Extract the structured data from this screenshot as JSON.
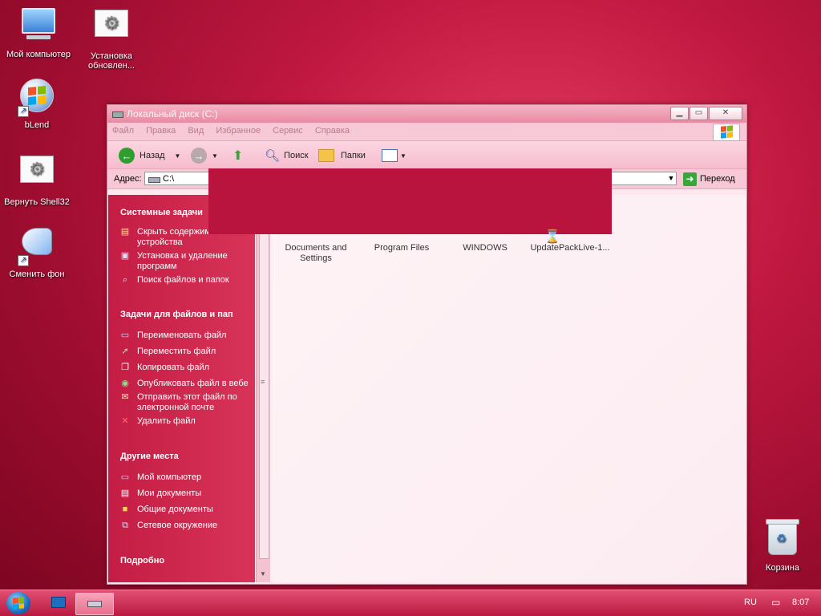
{
  "desktop": {
    "icons": [
      {
        "label": "Мой компьютер"
      },
      {
        "label": "Установка обновлен..."
      },
      {
        "label": "bLend"
      },
      {
        "label": "Вернуть Shell32"
      },
      {
        "label": "Сменить фон"
      },
      {
        "label": "Корзина"
      }
    ]
  },
  "window": {
    "title": "Локальный диск (C:)",
    "menu": [
      "Файл",
      "Правка",
      "Вид",
      "Избранное",
      "Сервис",
      "Справка"
    ],
    "toolbar": {
      "back": "Назад",
      "search": "Поиск",
      "folders": "Папки"
    },
    "address": {
      "label": "Адрес:",
      "value": "C:\\",
      "go": "Переход"
    },
    "sidebar": {
      "sections": [
        {
          "title": "Системные задачи",
          "items": [
            {
              "label": "Скрыть содержимое этого устройства",
              "icon": "drive-icon"
            },
            {
              "label": "Установка и удаление программ",
              "icon": "programs-icon"
            },
            {
              "label": "Поиск файлов и папок",
              "icon": "search-icon"
            }
          ]
        },
        {
          "title": "Задачи для файлов и пап",
          "items": [
            {
              "label": "Переименовать файл",
              "icon": "rename-icon"
            },
            {
              "label": "Переместить файл",
              "icon": "move-icon"
            },
            {
              "label": "Копировать файл",
              "icon": "copy-icon"
            },
            {
              "label": "Опубликовать файл в вебе",
              "icon": "web-icon"
            },
            {
              "label": "Отправить этот файл по электронной почте",
              "icon": "mail-icon"
            },
            {
              "label": "Удалить файл",
              "icon": "delete-icon"
            }
          ]
        },
        {
          "title": "Другие места",
          "items": [
            {
              "label": "Мой компьютер",
              "icon": "computer-icon"
            },
            {
              "label": "Мои документы",
              "icon": "documents-icon"
            },
            {
              "label": "Общие документы",
              "icon": "folder-icon"
            },
            {
              "label": "Сетевое окружение",
              "icon": "network-icon"
            }
          ]
        },
        {
          "title": "Подробно",
          "items": []
        }
      ]
    },
    "files": [
      {
        "name": "Documents and Settings"
      },
      {
        "name": "Program Files"
      },
      {
        "name": "WINDOWS"
      },
      {
        "name": "UpdatePackLive-1..."
      }
    ]
  },
  "taskbar": {
    "lang": "RU",
    "time": "8:07"
  },
  "colors": {
    "accent": "#c41d45",
    "taskbar": "#d4305a"
  }
}
